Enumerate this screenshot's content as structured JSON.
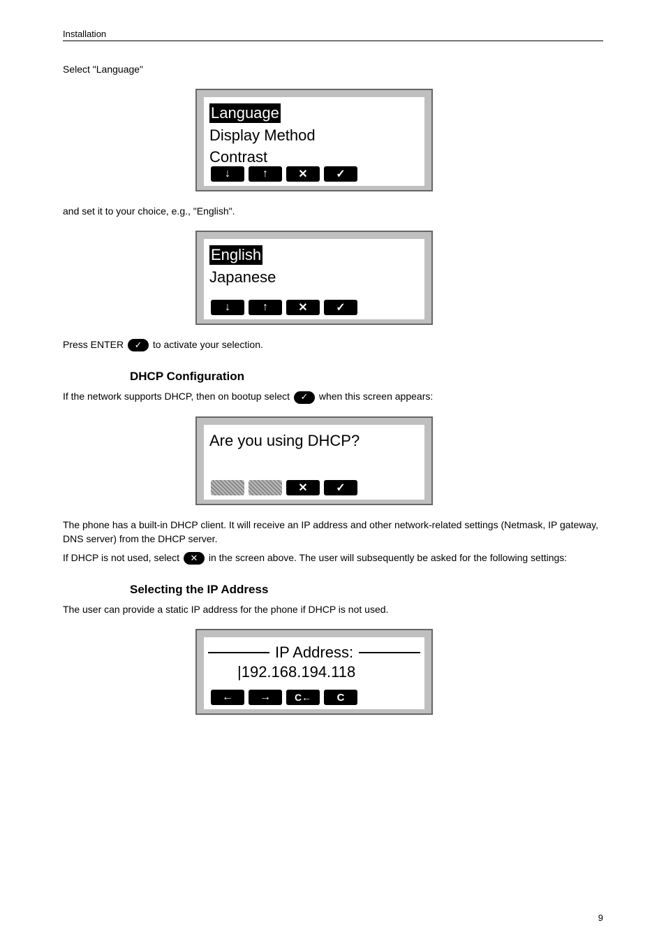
{
  "header": {
    "title": "Installation"
  },
  "body": {
    "p1": "Select \"Language\"",
    "p2": "and set it to your choice, e.g., \"English\".",
    "p3_a": "Press ENTER ",
    "p3_b": " to activate your selection.",
    "h2_dhcp": "DHCP Configuration",
    "p4_a": "If the network supports DHCP, then on bootup select ",
    "p4_b": " when this screen appears:",
    "p5": "The phone has a built-in DHCP client.  It will receive an IP address and other network-related settings (Netmask, IP gateway, DNS server) from the DHCP server.",
    "p6_a": "If DHCP is not used, select ",
    "p6_b": " in the screen above.  The user will subsequently be asked for the following settings:",
    "h2_ip": "Selecting the IP Address",
    "p7": "The user can provide a static IP address for the phone if DHCP is not used."
  },
  "screens": {
    "s1": {
      "line1": "Language",
      "line2": "Display Method",
      "line3": "Contrast",
      "keys": [
        "↓",
        "↑",
        "✕",
        "✓"
      ]
    },
    "s2": {
      "line1": "English",
      "line2": "Japanese",
      "keys": [
        "↓",
        "↑",
        "✕",
        "✓"
      ]
    },
    "s3": {
      "line1": "Are you using DHCP?",
      "keys_disabled": [
        true,
        true,
        false,
        false
      ],
      "keys": [
        "",
        "",
        "✕",
        "✓"
      ]
    },
    "s4": {
      "title": "IP Address:",
      "value": "192.168.194.118",
      "keys": [
        "←",
        "→",
        "C←",
        "C"
      ]
    }
  },
  "inline": {
    "enter_key": "✓",
    "ok_key": "✓",
    "cancel_key": "✕"
  },
  "footer": {
    "page": "9"
  }
}
